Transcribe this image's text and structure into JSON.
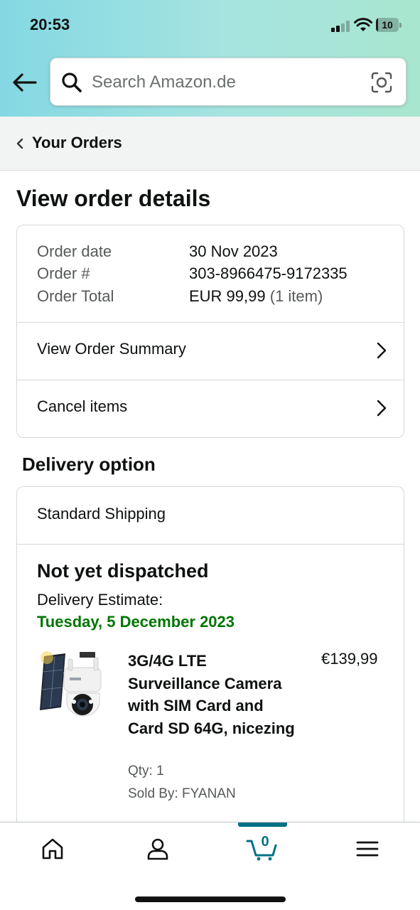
{
  "status_bar": {
    "time": "20:53",
    "battery": "10"
  },
  "header": {
    "search_placeholder": "Search Amazon.de",
    "icons": [
      "back-arrow-icon",
      "search-icon",
      "camera-icon"
    ]
  },
  "breadcrumb": {
    "label": "Your Orders"
  },
  "page": {
    "title": "View order details"
  },
  "order": {
    "date_label": "Order date",
    "date_value": "30 Nov 2023",
    "number_label": "Order #",
    "number_value": "303-8966475-9172335",
    "total_label": "Order Total",
    "total_value": "EUR 99,99",
    "total_items": "(1 item)",
    "summary_link": "View Order Summary",
    "cancel_link": "Cancel items"
  },
  "delivery": {
    "section_title": "Delivery option",
    "shipping_method": "Standard Shipping",
    "status": "Not yet dispatched",
    "estimate_label": "Delivery Estimate:",
    "estimate_date": "Tuesday, 5 December 2023"
  },
  "product": {
    "title": "3G/4G LTE Surveillance Camera with SIM Card and Card SD 64G, nicezing",
    "price": "€139,99",
    "qty": "Qty: 1",
    "sold_by_label": "Sold By:",
    "seller": "FYANAN",
    "image_icon": "product-camera-image"
  },
  "bottom_nav": {
    "items": [
      "home-icon",
      "account-icon",
      "cart-icon",
      "menu-icon"
    ],
    "cart_count": "0",
    "active": "cart"
  },
  "colors": {
    "header_gradient_start": "#84d8e3",
    "header_gradient_end": "#a9e6cf",
    "delivery_green": "#007600",
    "accent_teal": "#007185"
  }
}
